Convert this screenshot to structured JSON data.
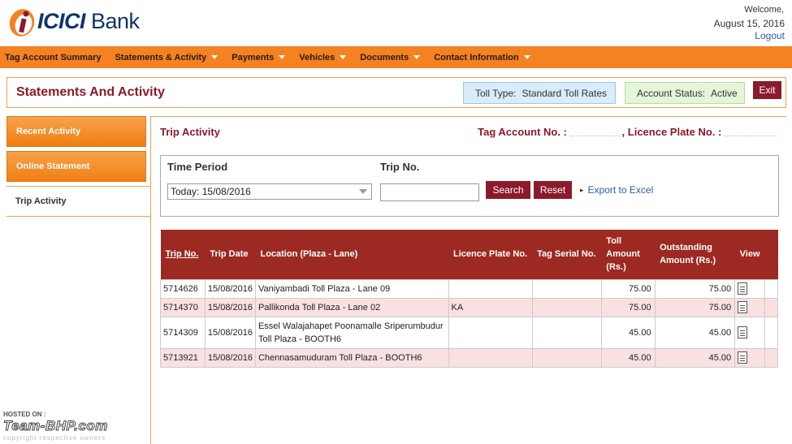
{
  "header": {
    "logo_text": "ICICI Bank",
    "welcome": "Welcome,",
    "date": "August 15, 2016",
    "logout": "Logout"
  },
  "nav": {
    "items": [
      {
        "label": "Tag Account Summary",
        "dropdown": false
      },
      {
        "label": "Statements & Activity",
        "dropdown": true
      },
      {
        "label": "Payments",
        "dropdown": true
      },
      {
        "label": "Vehicles",
        "dropdown": true
      },
      {
        "label": "Documents",
        "dropdown": true
      },
      {
        "label": "Contact Information",
        "dropdown": true
      }
    ]
  },
  "titlebar": {
    "title": "Statements And Activity",
    "toll_type_label": "Toll Type:",
    "toll_type_value": "Standard Toll Rates",
    "account_status_label": "Account Status:",
    "account_status_value": "Active",
    "exit": "Exit"
  },
  "sidebar": {
    "items": [
      {
        "label": "Recent Activity"
      },
      {
        "label": "Online Statement"
      },
      {
        "label": "Trip Activity"
      }
    ]
  },
  "main": {
    "title": "Trip Activity",
    "tag_account_label": "Tag Account No. :",
    "licence_plate_label": ", Licence Plate No. :"
  },
  "filter": {
    "time_period_label": "Time Period",
    "time_period_value": "Today: 15/08/2016",
    "trip_no_label": "Trip No.",
    "search": "Search",
    "reset": "Reset",
    "export": "Export to Excel"
  },
  "table": {
    "headers": [
      "Trip No.",
      "Trip Date",
      "Location (Plaza - Lane)",
      "Licence Plate No.",
      "Tag Serial No.",
      "Toll Amount (Rs.)",
      "Outstanding Amount (Rs.)",
      "View"
    ],
    "rows": [
      {
        "trip_no": "5714626",
        "date": "15/08/2016",
        "location": "Vaniyambadi Toll Plaza - Lane 09",
        "plate": "",
        "serial": "",
        "toll": "75.00",
        "outstanding": "75.00"
      },
      {
        "trip_no": "5714370",
        "date": "15/08/2016",
        "location": "Pallikonda Toll Plaza - Lane 02",
        "plate": "KA",
        "serial": "",
        "toll": "75.00",
        "outstanding": "75.00"
      },
      {
        "trip_no": "5714309",
        "date": "15/08/2016",
        "location": "Essel Walajahapet Poonamalle Sriperumbudur Toll Plaza - BOOTH6",
        "plate": "",
        "serial": "",
        "toll": "45.00",
        "outstanding": "45.00"
      },
      {
        "trip_no": "5713921",
        "date": "15/08/2016",
        "location": "Chennasamuduram Toll Plaza - BOOTH6",
        "plate": "",
        "serial": "",
        "toll": "45.00",
        "outstanding": "45.00"
      }
    ]
  },
  "watermark": {
    "hosted": "HOSTED ON :",
    "site": "Team-BHP.com",
    "copyright": "copyright respective owners"
  },
  "colors": {
    "brand_orange": "#f58220",
    "brand_maroon": "#8b1a2b",
    "table_header": "#9c2a22",
    "row_alt": "#f9e1e2"
  }
}
